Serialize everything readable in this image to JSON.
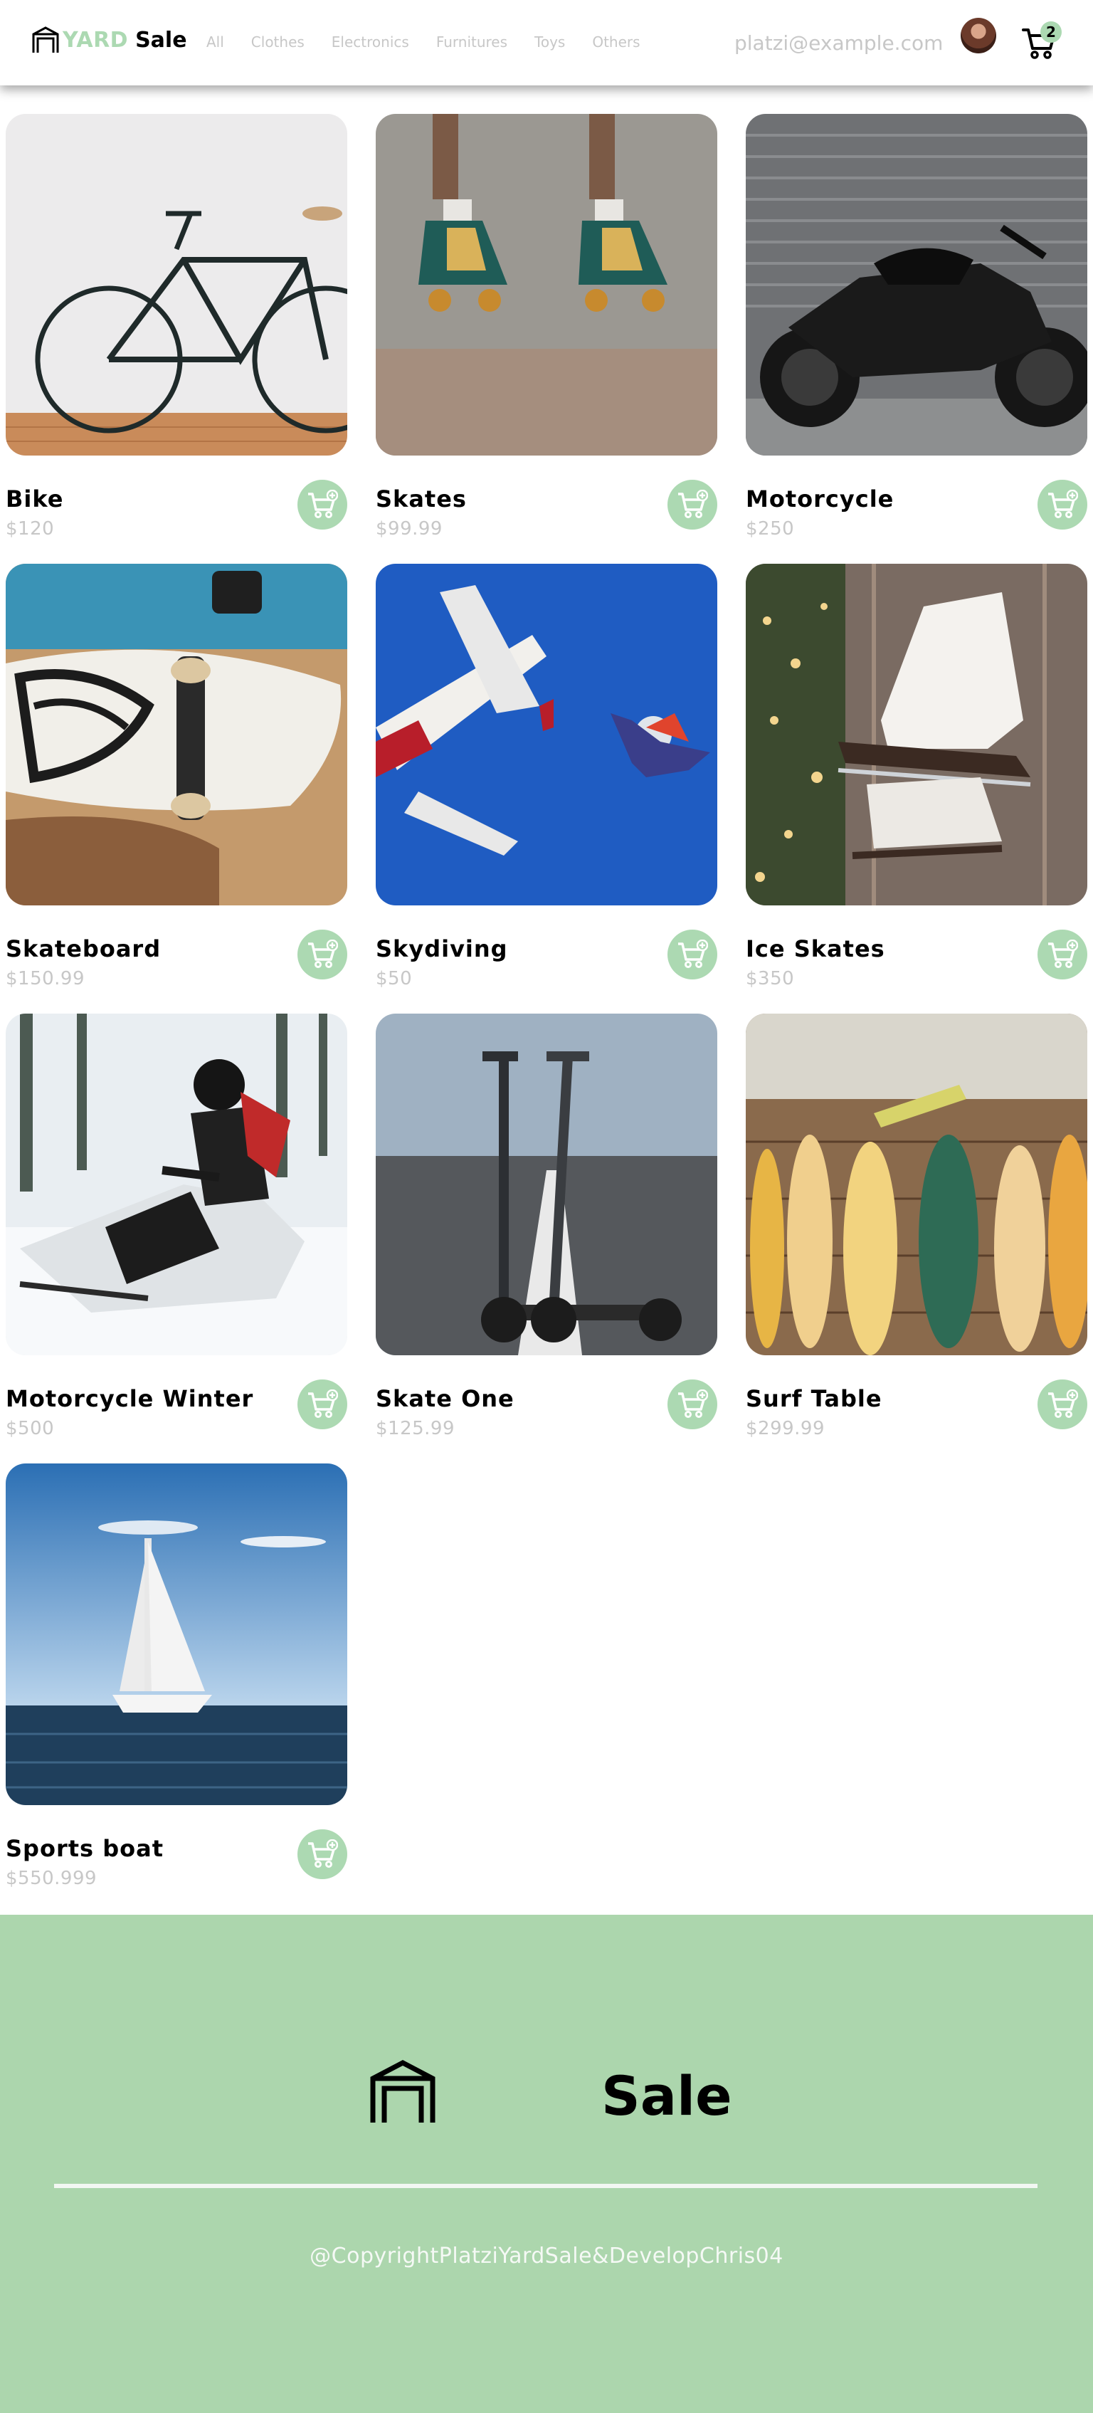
{
  "brand": {
    "yard": "YARD",
    "sale": "Sale",
    "accent": "#acd9b2"
  },
  "nav": {
    "categories": [
      "All",
      "Clothes",
      "Electronics",
      "Furnitures",
      "Toys",
      "Others"
    ],
    "user_email": "platzi@example.com",
    "cart_count": "2",
    "avatar_icon": "avatar-photo",
    "cart_icon": "shopping-cart-icon"
  },
  "products": [
    {
      "name": "Bike",
      "price": "$120",
      "image": "bike-photo"
    },
    {
      "name": "Skates",
      "price": "$99.99",
      "image": "roller-skates-photo"
    },
    {
      "name": "Motorcycle",
      "price": "$250",
      "image": "motorcycle-photo"
    },
    {
      "name": "Skateboard",
      "price": "$150.99",
      "image": "skateboard-photo"
    },
    {
      "name": "Skydiving",
      "price": "$50",
      "image": "skydiving-photo"
    },
    {
      "name": "Ice Skates",
      "price": "$350",
      "image": "ice-skates-photo"
    },
    {
      "name": "Motorcycle Winter",
      "price": "$500",
      "image": "snowmobile-photo"
    },
    {
      "name": "Skate One",
      "price": "$125.99",
      "image": "scooter-photo"
    },
    {
      "name": "Surf Table",
      "price": "$299.99",
      "image": "surfboards-photo"
    },
    {
      "name": "Sports boat",
      "price": "$550.999",
      "image": "sailboat-photo"
    }
  ],
  "add_to_cart_icon": "add-to-cart-icon",
  "footer": {
    "sale": "Sale",
    "copyright": "@CopyrightPlatziYardSale&DevelopChris04",
    "background": "#acd6ad"
  }
}
